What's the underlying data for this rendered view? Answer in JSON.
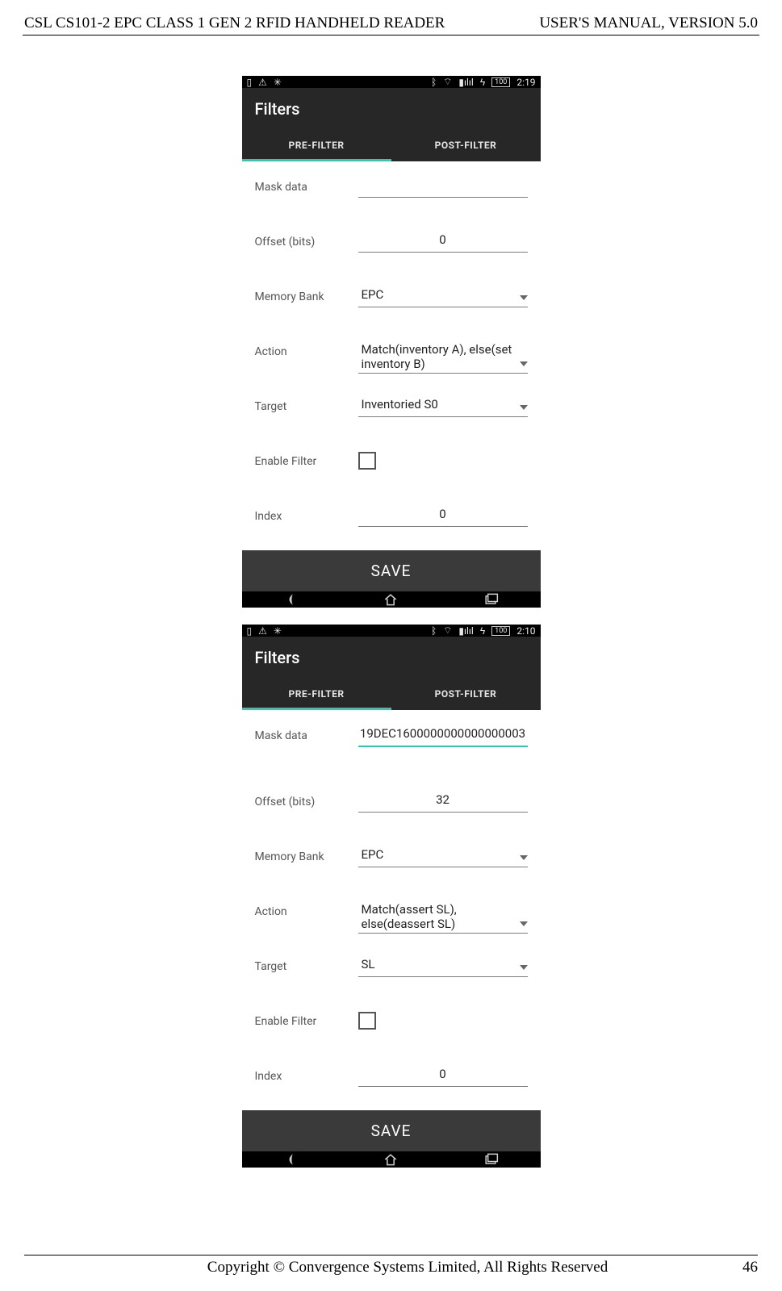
{
  "header": {
    "left": "CSL CS101-2 EPC CLASS 1 GEN 2 RFID HANDHELD READER",
    "right": "USER'S  MANUAL,  VERSION  5.0"
  },
  "footer": {
    "text": "Copyright © Convergence Systems Limited, All Rights Reserved",
    "page": "46"
  },
  "screen1": {
    "time": "2:19",
    "title": "Filters",
    "tab1": "PRE-FILTER",
    "tab2": "POST-FILTER",
    "rows": {
      "mask_label": "Mask data",
      "mask_value": "",
      "offset_label": "Offset (bits)",
      "offset_value": "0",
      "mem_label": "Memory Bank",
      "mem_value": "EPC",
      "action_label": "Action",
      "action_value": "Match(inventory A), else(set inventory B)",
      "target_label": "Target",
      "target_value": "Inventoried S0",
      "enable_label": "Enable Filter",
      "index_label": "Index",
      "index_value": "0"
    },
    "save": "SAVE"
  },
  "screen2": {
    "time": "2:10",
    "title": "Filters",
    "tab1": "PRE-FILTER",
    "tab2": "POST-FILTER",
    "rows": {
      "mask_label": "Mask data",
      "mask_value": "19DEC1600000000000000003",
      "offset_label": "Offset (bits)",
      "offset_value": "32",
      "mem_label": "Memory Bank",
      "mem_value": "EPC",
      "action_label": "Action",
      "action_value": "Match(assert SL), else(deassert SL)",
      "target_label": "Target",
      "target_value": "SL",
      "enable_label": "Enable Filter",
      "index_label": "Index",
      "index_value": "0"
    },
    "save": "SAVE"
  }
}
